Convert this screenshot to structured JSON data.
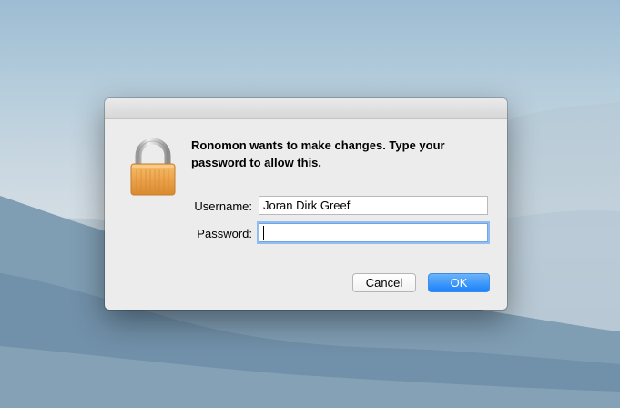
{
  "dialog": {
    "icon": "padlock-icon",
    "message": "Ronomon wants to make changes. Type your password to allow this.",
    "username_label": "Username:",
    "username_value": "Joran Dirk Greef",
    "password_label": "Password:",
    "password_value": "",
    "cancel_label": "Cancel",
    "ok_label": "OK"
  },
  "colors": {
    "accent": "#1a82fb",
    "dialog_background": "#ececec",
    "lock_body": "#eca24a",
    "focus_ring": "#92bdf0"
  }
}
